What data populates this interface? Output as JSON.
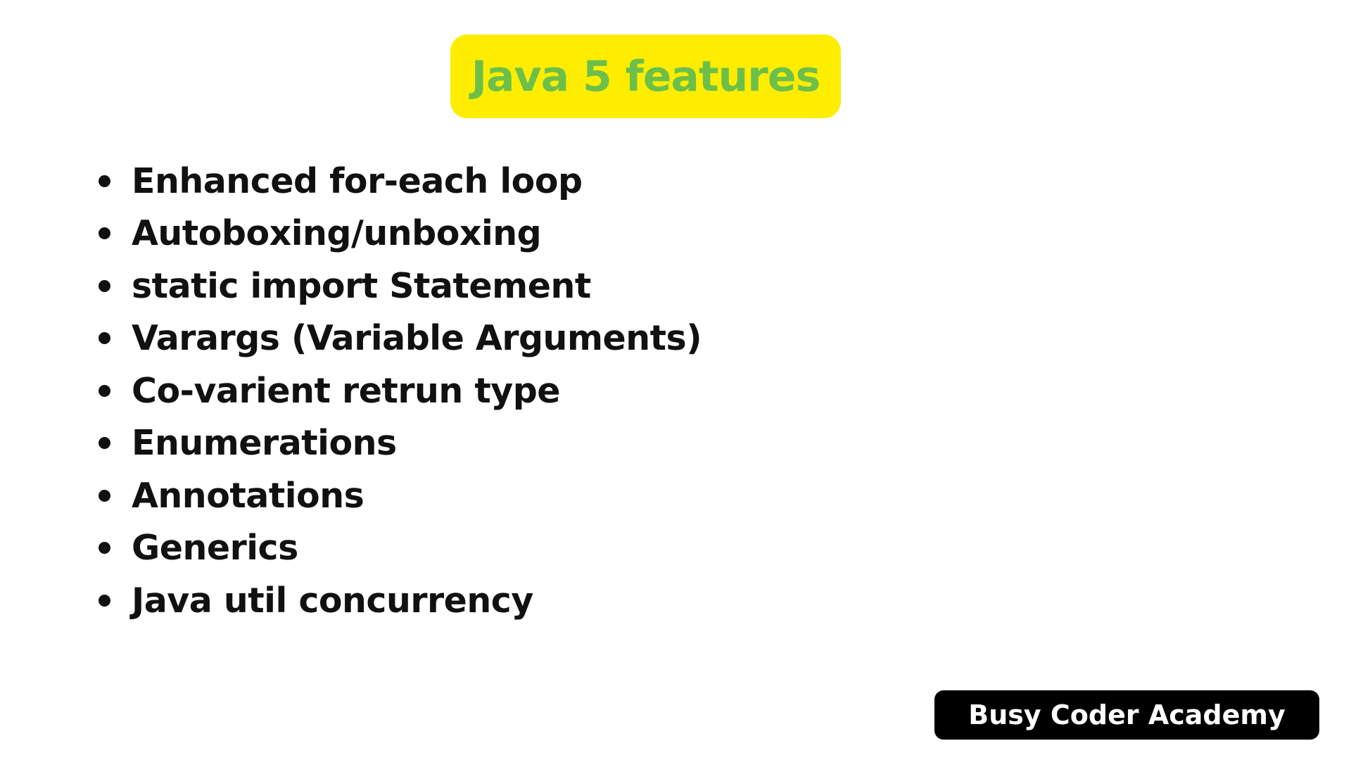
{
  "title": "Java 5 features",
  "features": [
    "Enhanced for-each loop",
    "Autoboxing/unboxing",
    "static import Statement",
    "Varargs (Variable Arguments)",
    "Co-varient retrun type",
    "Enumerations",
    "Annotations",
    "Generics",
    "Java util concurrency"
  ],
  "brand": "Busy Coder Academy",
  "colors": {
    "background": "#ffffff",
    "title_box": "#ffed00",
    "title_text": "#6cc04a",
    "body_text": "#111111",
    "brand_box": "#000000",
    "brand_text": "#ffffff"
  }
}
